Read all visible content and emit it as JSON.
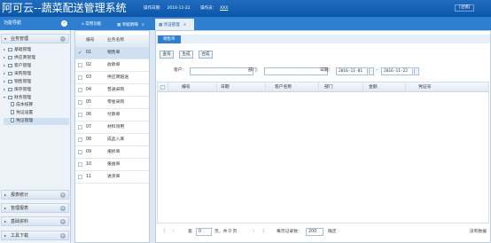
{
  "header": {
    "title": "阿可云--蔬菜配送管理系统",
    "date_label": "操作日期：",
    "date_value": "2016-11-22",
    "operator_label": "操作员：",
    "operator_value": "XXX",
    "logout": "[注销]"
  },
  "sidebar": {
    "title": "功能导航",
    "collapse_symbol": "«",
    "top_section": "业务管理",
    "tree": [
      {
        "label": "基础管理",
        "level": 0,
        "expanded": false
      },
      {
        "label": "供应商管理",
        "level": 0,
        "expanded": false
      },
      {
        "label": "客户管理",
        "level": 0,
        "expanded": false
      },
      {
        "label": "采购管理",
        "level": 0,
        "expanded": false
      },
      {
        "label": "销售管理",
        "level": 0,
        "expanded": false
      },
      {
        "label": "库存管理",
        "level": 0,
        "expanded": false
      },
      {
        "label": "财务管理",
        "level": 0,
        "expanded": true
      },
      {
        "label": "成本核算",
        "level": 1
      },
      {
        "label": "凭证设置",
        "level": 1
      },
      {
        "label": "凭证管理",
        "level": 1,
        "selected": true
      }
    ],
    "bottom_sections": [
      "报表统计",
      "管理报表",
      "基础资料",
      "工具下载"
    ]
  },
  "tabs": [
    {
      "label": "常用功能",
      "active": false
    },
    {
      "label": "单据明细",
      "active": false
    },
    {
      "label": "凭证管理",
      "active": true
    }
  ],
  "voucher_types": {
    "tab": "主页",
    "columns": [
      "编号",
      "业务名称"
    ],
    "rows": [
      {
        "id": "01",
        "name": "销售单",
        "selected": true
      },
      {
        "id": "02",
        "name": "收款单"
      },
      {
        "id": "03",
        "name": "供应商赔送"
      },
      {
        "id": "04",
        "name": "普通采购"
      },
      {
        "id": "05",
        "name": "零星采购"
      },
      {
        "id": "06",
        "name": "付款单"
      },
      {
        "id": "07",
        "name": "材料领用"
      },
      {
        "id": "08",
        "name": "成品入库"
      },
      {
        "id": "09",
        "name": "报损单"
      },
      {
        "id": "10",
        "name": "报益单"
      },
      {
        "id": "11",
        "name": "进货单"
      }
    ]
  },
  "main": {
    "subtab": "销售单",
    "buttons": [
      "查询",
      "生成",
      "合成"
    ],
    "filters": {
      "customer_label": "客户：",
      "customer_value": "",
      "dept_label": "部门：",
      "dept_value": "",
      "date_label": "日期：",
      "date_from": "2016-11-01",
      "date_sep": "-",
      "date_to": "2016-11-22"
    },
    "columns": [
      "编号",
      "日期",
      "客户名称",
      "部门",
      "金额",
      "凭证号"
    ]
  },
  "pager": {
    "first": "《",
    "prev": "〈",
    "page_label": "第",
    "page_value": "0",
    "page_total": "页，共 0 页",
    "next": "〉",
    "last": "》",
    "per_page_label": "每页记录数：",
    "per_page_value": "200",
    "confirm": "确定",
    "empty": "没有数据"
  }
}
